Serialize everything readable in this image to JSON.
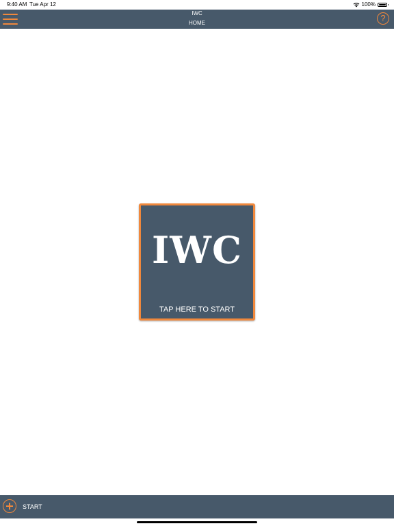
{
  "status_bar": {
    "time": "9:40 AM",
    "date": "Tue Apr 12",
    "battery": "100%",
    "wifi_icon": "wifi-icon",
    "battery_icon": "battery-icon"
  },
  "header": {
    "title": "IWC",
    "subtitle": "HOME",
    "menu_icon": "hamburger-menu-icon",
    "help_icon": "help-question-icon",
    "help_glyph": "?"
  },
  "main": {
    "logo": "IWC",
    "caption": "TAP HERE TO START"
  },
  "footer": {
    "add_icon": "plus-circle-icon",
    "start_label": "START"
  },
  "colors": {
    "bar": "#47596a",
    "accent": "#f0883c",
    "background": "#ffffff"
  }
}
